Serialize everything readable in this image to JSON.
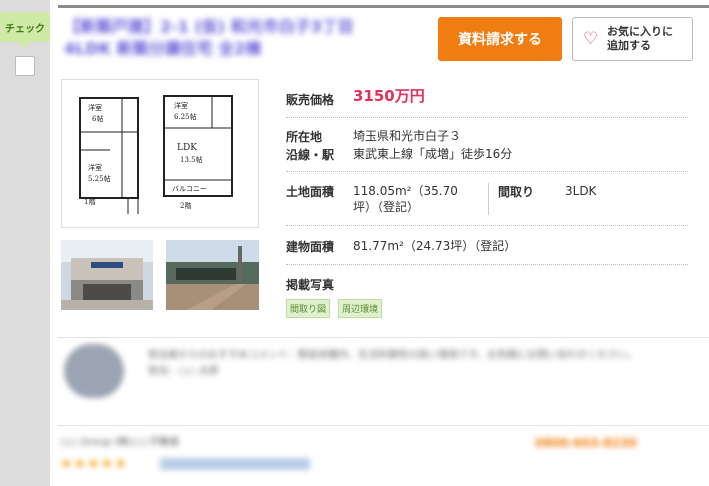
{
  "check": {
    "label": "チェック"
  },
  "title": "【新築戸建】2-1 (仮) 和光市白子3丁目 4LDK 新築分譲住宅 全2棟",
  "buttons": {
    "request": "資料請求する",
    "favorite": "お気に入りに追加する"
  },
  "floorplan": {
    "rooms": [
      "洋室",
      "6帖",
      "洋室",
      "6.25帖",
      "洋室",
      "5.25帖",
      "LDK",
      "13.5帖",
      "バルコニー"
    ],
    "floor1": "1階",
    "floor2": "2階"
  },
  "details": {
    "price_label": "販売価格",
    "price_value": "3150万円",
    "location_label": "所在地",
    "location_value": "埼玉県和光市白子３",
    "station_label": "沿線・駅",
    "station_value": "東武東上線「成増」徒歩16分",
    "land_label": "土地面積",
    "land_value": "118.05m²（35.70坪）（登記）",
    "layout_label": "間取り",
    "layout_value": "3LDK",
    "building_label": "建物面積",
    "building_value": "81.77m²（24.73坪）（登記）",
    "photos_label": "掲載写真",
    "photo_tags": [
      "間取り図",
      "周辺環境"
    ]
  },
  "agent": {
    "comment": "担当者からのおすすめコメント：駅徒歩圏内、生活利便性の高い環境です。お気軽にお問い合わせください。",
    "name": "担当：○○ 太郎",
    "company": "○○ Group (株)○○不動産",
    "phone": "0800-603-8230"
  },
  "colors": {
    "accent": "#f07d12",
    "price": "#e2305a",
    "check_tab": "#cfe9a6"
  }
}
